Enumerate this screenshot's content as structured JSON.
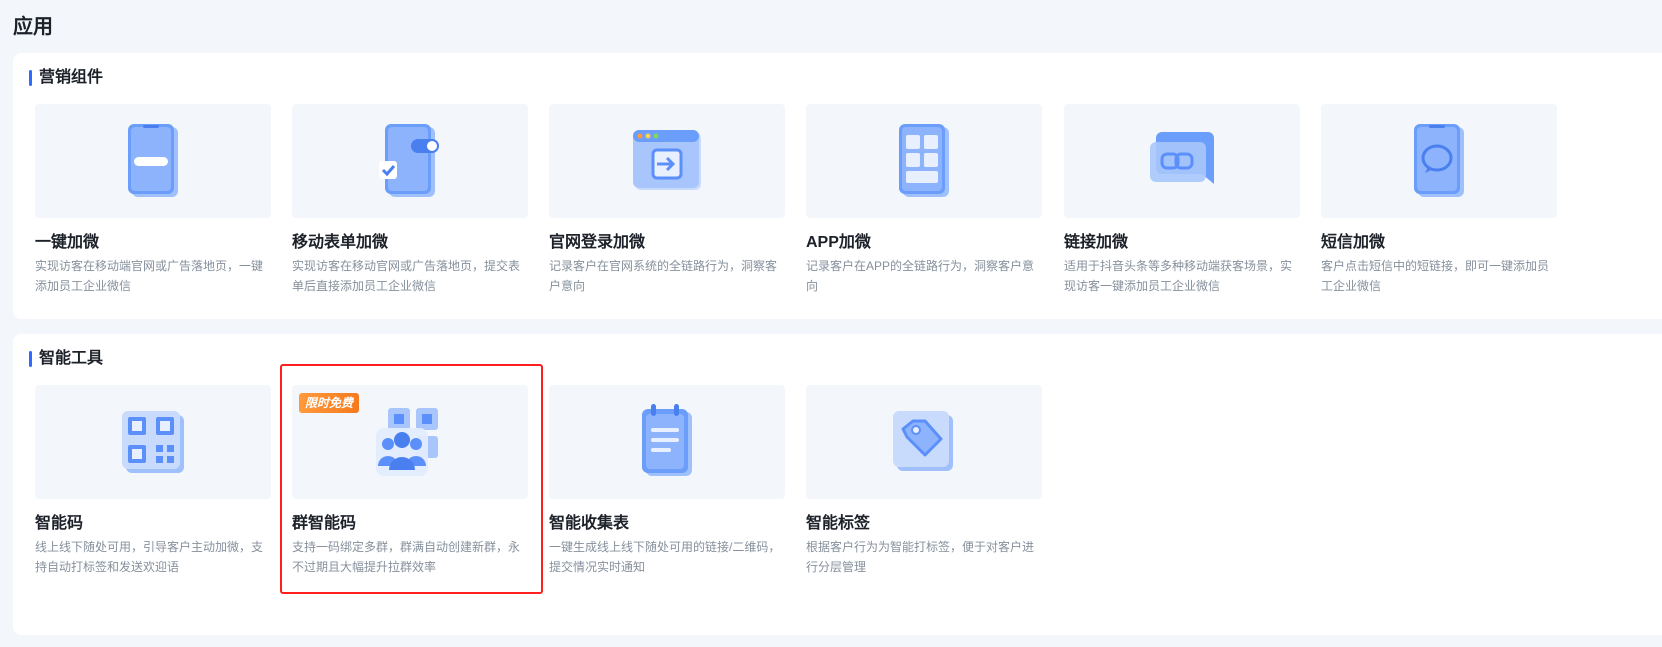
{
  "page": {
    "title": "应用"
  },
  "colors": {
    "accent": "#2f6bff",
    "icon_blue": "#5b8ff9",
    "badge_orange": "#f57a1f",
    "highlight_red": "#ff1f1f"
  },
  "marketing": {
    "title": "营销组件",
    "cards": [
      {
        "name": "一键加微",
        "desc": "实现访客在移动端官网或广告落地页，一键添加员工企业微信",
        "icon": "phone-minus-icon"
      },
      {
        "name": "移动表单加微",
        "desc": "实现访客在移动官网或广告落地页，提交表单后直接添加员工企业微信",
        "icon": "phone-form-toggle-icon"
      },
      {
        "name": "官网登录加微",
        "desc": "记录客户在官网系统的全链路行为，洞察客户意向",
        "icon": "browser-login-icon"
      },
      {
        "name": "APP加微",
        "desc": "记录客户在APP的全链路行为，洞察客户意向",
        "icon": "app-grid-icon"
      },
      {
        "name": "链接加微",
        "desc": "适用于抖音头条等多种移动端获客场景，实现访客一键添加员工企业微信",
        "icon": "link-chat-icon"
      },
      {
        "name": "短信加微",
        "desc": "客户点击短信中的短链接，即可一键添加员工企业微信",
        "icon": "sms-phone-icon"
      }
    ]
  },
  "tools": {
    "title": "智能工具",
    "cards": [
      {
        "name": "智能码",
        "desc": "线上线下随处可用，引导客户主动加微，支持自动打标签和发送欢迎语",
        "icon": "qr-code-icon"
      },
      {
        "name": "群智能码",
        "desc": "支持一码绑定多群，群满自动创建新群，永不过期且大幅提升拉群效率",
        "icon": "group-qr-icon",
        "badge": "限时免费"
      },
      {
        "name": "智能收集表",
        "desc": "一键生成线上线下随处可用的链接/二维码，提交情况实时通知",
        "icon": "notepad-icon"
      },
      {
        "name": "智能标签",
        "desc": "根据客户行为为智能打标签，便于对客户进行分层管理",
        "icon": "tag-icon"
      }
    ]
  }
}
